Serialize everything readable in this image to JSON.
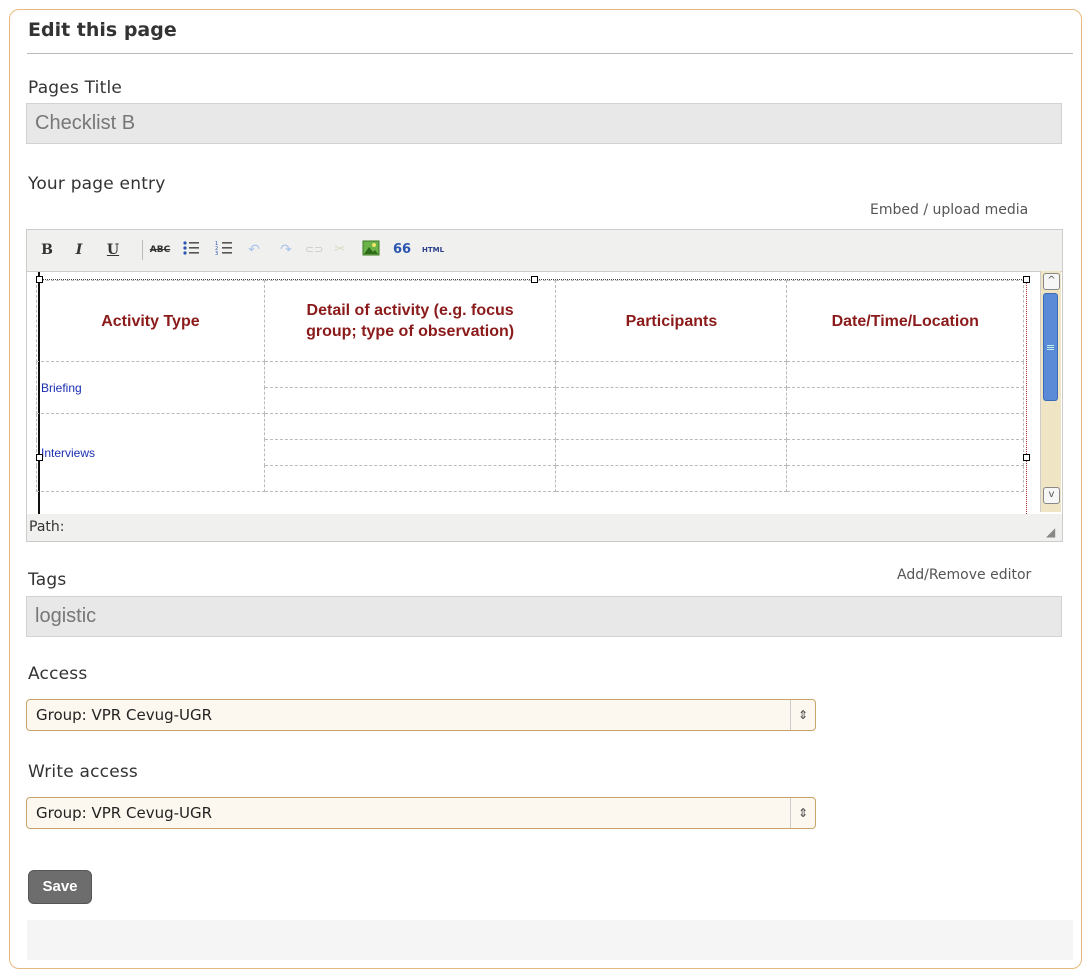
{
  "panel": {
    "title": "Edit this page"
  },
  "page_title": {
    "label": "Pages Title",
    "value": "Checklist B"
  },
  "entry": {
    "label": "Your page entry",
    "embed_link": "Embed / upload media",
    "toolbar": {
      "bold": "B",
      "italic": "I",
      "underline": "U",
      "strike": "ABC",
      "blockquote": "66",
      "html": "HTML"
    },
    "table": {
      "headers": [
        "Activity Type",
        "Detail of activity (e.g. focus group; type of observation)",
        "Participants",
        "Date/Time/Location"
      ],
      "rows": [
        "Briefing",
        "Interviews"
      ]
    },
    "path_label": "Path:",
    "editor_toggle": "Add/Remove editor"
  },
  "tags": {
    "label": "Tags",
    "value": "logistic"
  },
  "access": {
    "label": "Access",
    "selected": "Group: VPR Cevug-UGR"
  },
  "write_access": {
    "label": "Write access",
    "selected": "Group: VPR Cevug-UGR"
  },
  "save_label": "Save"
}
